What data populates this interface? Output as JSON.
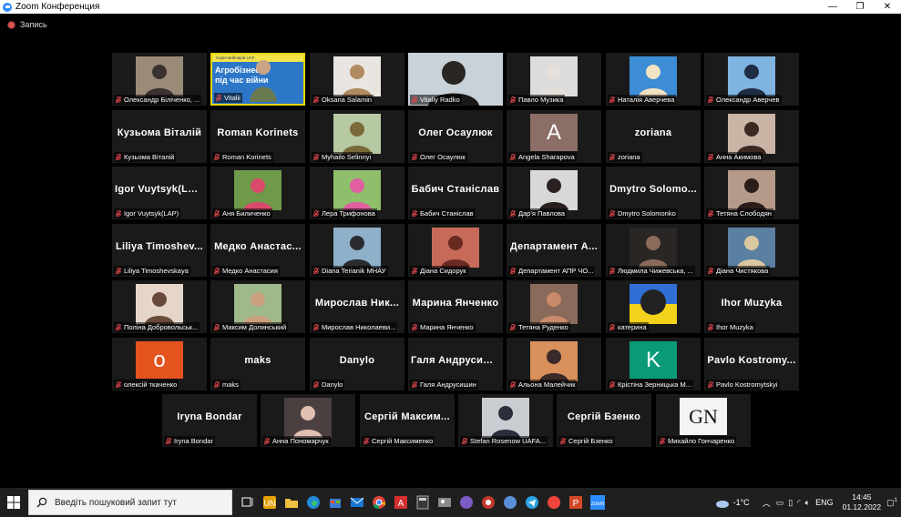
{
  "window": {
    "title": "Zoom Конференция",
    "minimize": "—",
    "maximize": "❐",
    "close": "✕"
  },
  "recording": {
    "label": "Запись"
  },
  "tiles": [
    {
      "row": 0,
      "col": 0,
      "kind": "photo",
      "label": "Олександр Біліченко, ...",
      "bg": "#9a8b78",
      "person": "#3a3230"
    },
    {
      "row": 0,
      "col": 1,
      "kind": "share",
      "label": "Vitalii",
      "active": true,
      "banner_top": "Серія вебінарів UAF",
      "banner_main1": "Агробізнес",
      "banner_main2": "під час війни"
    },
    {
      "row": 0,
      "col": 2,
      "kind": "photo",
      "label": "Oksana Salamin",
      "bg": "#e9e6e2",
      "person": "#b08a60"
    },
    {
      "row": 0,
      "col": 3,
      "kind": "full",
      "label": "Vitaliy Radko",
      "bg": "#c9d1d9",
      "person": "#2a2622"
    },
    {
      "row": 0,
      "col": 4,
      "kind": "photo",
      "label": "Павло Музика",
      "bg": "#dcdcdc",
      "person": "#e7e0da"
    },
    {
      "row": 0,
      "col": 5,
      "kind": "photo",
      "label": "Наталія Аверчева",
      "bg": "#3d8dd6",
      "person": "#f2e3c4"
    },
    {
      "row": 0,
      "col": 6,
      "kind": "photo",
      "label": "Олександр Аверчев",
      "bg": "#7fb3e0",
      "person": "#1e2c44"
    },
    {
      "row": 1,
      "col": 0,
      "kind": "name",
      "big": "Кузьома Віталій",
      "label": "Кузьома Віталій"
    },
    {
      "row": 1,
      "col": 1,
      "kind": "name",
      "big": "Roman Korinets",
      "label": "Roman Korinets"
    },
    {
      "row": 1,
      "col": 2,
      "kind": "photo",
      "label": "Myhailo Selinnyi",
      "bg": "#b7c9a2",
      "person": "#7a6a3a"
    },
    {
      "row": 1,
      "col": 3,
      "kind": "name",
      "big": "Олег Осаулюк",
      "label": "Олег Осаулюк"
    },
    {
      "row": 1,
      "col": 4,
      "kind": "avatar",
      "letter": "A",
      "label": "Angela Sharapova",
      "bg": "#8b6e66"
    },
    {
      "row": 1,
      "col": 5,
      "kind": "name",
      "big": "zoriana",
      "label": "zoriana"
    },
    {
      "row": 1,
      "col": 6,
      "kind": "photo",
      "label": "Анна Акимова",
      "bg": "#c9b4a6",
      "person": "#3b2a22"
    },
    {
      "row": 2,
      "col": 0,
      "kind": "name",
      "big": "Igor Vuytsyk(LA...",
      "label": "Igor Vuytsyk(LAP)"
    },
    {
      "row": 2,
      "col": 1,
      "kind": "photo",
      "label": "Аня Биличенко",
      "bg": "#6f9a4a",
      "person": "#d94a6a"
    },
    {
      "row": 2,
      "col": 2,
      "kind": "photo",
      "label": "Лера Трифонова",
      "bg": "#8fbf6a",
      "person": "#e05fa0"
    },
    {
      "row": 2,
      "col": 3,
      "kind": "name",
      "big": "Бабич Станіслав",
      "label": "Бабич Станіслав"
    },
    {
      "row": 2,
      "col": 4,
      "kind": "photo",
      "label": "Дар'я Павлова",
      "bg": "#d8d8d8",
      "person": "#2a2020"
    },
    {
      "row": 2,
      "col": 5,
      "kind": "name",
      "big": "Dmytro Solomo...",
      "label": "Dmytro Solomonko"
    },
    {
      "row": 2,
      "col": 6,
      "kind": "photo",
      "label": "Тетяна Слободян",
      "bg": "#b59a8a",
      "person": "#2b1e1a"
    },
    {
      "row": 3,
      "col": 0,
      "kind": "name",
      "big": "Liliya Timoshev...",
      "label": "Liliya Timoshevskaya"
    },
    {
      "row": 3,
      "col": 1,
      "kind": "name",
      "big": "Медко Анастас...",
      "label": "Медко Анастасия"
    },
    {
      "row": 3,
      "col": 2,
      "kind": "photo",
      "label": "Diana Terianik МНАУ",
      "bg": "#8fb0c9",
      "person": "#2a2a30"
    },
    {
      "row": 3,
      "col": 3,
      "kind": "photo",
      "label": "Діана Сидорук",
      "bg": "#c76a5a",
      "person": "#6a2a22"
    },
    {
      "row": 3,
      "col": 4,
      "kind": "name",
      "big": "Департамент А...",
      "label": "Департамент АПР ЧО..."
    },
    {
      "row": 3,
      "col": 5,
      "kind": "photo",
      "label": "Людмила Чижевська, ...",
      "bg": "#2a2624",
      "person": "#8a6a5a"
    },
    {
      "row": 3,
      "col": 6,
      "kind": "photo",
      "label": "Діана Чистякова",
      "bg": "#5a7fa0",
      "person": "#d9c7a0"
    },
    {
      "row": 4,
      "col": 0,
      "kind": "photo",
      "label": "Поліна Добровольськ...",
      "bg": "#e6d6c9",
      "person": "#6a4a3a"
    },
    {
      "row": 4,
      "col": 1,
      "kind": "photo",
      "label": "Максим Долинський",
      "bg": "#9fb98a",
      "person": "#c9a080"
    },
    {
      "row": 4,
      "col": 2,
      "kind": "name",
      "big": "Мирослав Ник...",
      "label": "Мирослав Николаеви..."
    },
    {
      "row": 4,
      "col": 3,
      "kind": "name",
      "big": "Марина Янченко",
      "label": "Марина Янченко"
    },
    {
      "row": 4,
      "col": 4,
      "kind": "photo",
      "label": "Тетяна Руденко",
      "bg": "#8a6a5a",
      "person": "#c98a6a"
    },
    {
      "row": 4,
      "col": 5,
      "kind": "ukr",
      "label": "катерина"
    },
    {
      "row": 4,
      "col": 6,
      "kind": "name",
      "big": "Ihor Muzyka",
      "label": "Ihor Muzyka"
    },
    {
      "row": 5,
      "col": 0,
      "kind": "avatar",
      "letter": "о",
      "label": "олексій ткаченко",
      "bg": "#e5531f"
    },
    {
      "row": 5,
      "col": 1,
      "kind": "name",
      "big": "maks",
      "label": "maks"
    },
    {
      "row": 5,
      "col": 2,
      "kind": "name",
      "big": "Danylo",
      "label": "Danylo"
    },
    {
      "row": 5,
      "col": 3,
      "kind": "name",
      "big": "Галя Андрусиш...",
      "label": "Галя Андрусишин"
    },
    {
      "row": 5,
      "col": 4,
      "kind": "photo",
      "label": "Альона Малейчик",
      "bg": "#d9905a",
      "person": "#3a2a2a"
    },
    {
      "row": 5,
      "col": 5,
      "kind": "avatar",
      "letter": "K",
      "label": "Крістіна Зерницька М...",
      "bg": "#0a9a7a"
    },
    {
      "row": 5,
      "col": 6,
      "kind": "name",
      "big": "Pavlo Kostromy...",
      "label": "Pavlo Kostromytskyi"
    },
    {
      "row": 6,
      "col": 0,
      "kind": "name",
      "big": "Iryna Bondar",
      "label": "Iryna Bondar"
    },
    {
      "row": 6,
      "col": 1,
      "kind": "photo",
      "label": "Анна Пономарчук",
      "bg": "#4a4040",
      "person": "#e0c0b0"
    },
    {
      "row": 6,
      "col": 2,
      "kind": "name",
      "big": "Сергій Максим...",
      "label": "Сергій Максименко"
    },
    {
      "row": 6,
      "col": 3,
      "kind": "photo",
      "label": "Stefan Rosenow UAFA...",
      "bg": "#c9ccd0",
      "person": "#2a2e3a"
    },
    {
      "row": 6,
      "col": 4,
      "kind": "name",
      "big": "Сергій Бзенко",
      "label": "Сергій Бзенко"
    },
    {
      "row": 6,
      "col": 5,
      "kind": "gn",
      "text": "GN",
      "label": "Михайло Гончаренко"
    }
  ],
  "taskbar": {
    "search_placeholder": "Введіть пошуковий запит тут",
    "weather": "-1°C",
    "lang": "ENG",
    "time": "14:45",
    "date": "01.12.2022",
    "notif_count": "1"
  },
  "colors": {
    "accent": "#2d8cff",
    "active_border": "#e6d700",
    "muted_mic": "#e5484d"
  }
}
